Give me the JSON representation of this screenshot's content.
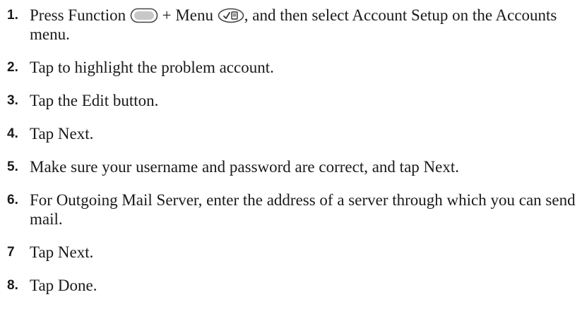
{
  "steps": [
    {
      "number": "1.",
      "part1": "Press Function",
      "part2": "+ Menu",
      "part3": ", and then select Account Setup on the Accounts menu.",
      "icons": [
        "function-key-icon",
        "menu-key-icon"
      ]
    },
    {
      "number": "2.",
      "text": "Tap to highlight the problem account."
    },
    {
      "number": "3.",
      "text": "Tap the Edit button."
    },
    {
      "number": "4.",
      "text": "Tap Next."
    },
    {
      "number": "5.",
      "text": "Make sure your username and password are correct, and tap Next."
    },
    {
      "number": "6.",
      "text": "For Outgoing Mail Server, enter the address of a server through which you can send mail."
    },
    {
      "number": "7",
      "text": "Tap Next."
    },
    {
      "number": "8.",
      "text": "Tap Done."
    }
  ]
}
